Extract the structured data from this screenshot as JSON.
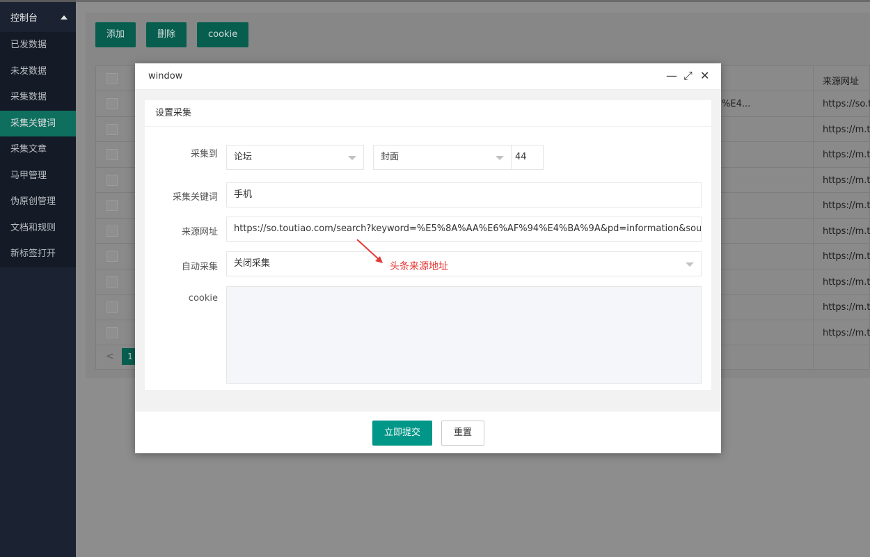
{
  "sidebar": {
    "header": "控制台",
    "items": [
      {
        "label": "已发数据"
      },
      {
        "label": "未发数据"
      },
      {
        "label": "采集数据"
      },
      {
        "label": "采集关键词",
        "active": true
      },
      {
        "label": "采集文章"
      },
      {
        "label": "马甲管理"
      },
      {
        "label": "伪原创管理"
      },
      {
        "label": "文档和规则"
      },
      {
        "label": "新标签打开"
      }
    ]
  },
  "toolbar": {
    "add_label": "添加",
    "delete_label": "删除",
    "cookie_label": "cookie"
  },
  "table": {
    "url_header": "来源网址",
    "rows": [
      {
        "mid": "%E4...",
        "url": "https://so.tou"
      },
      {
        "mid": "",
        "url": "https://m.tou"
      },
      {
        "mid": "",
        "url": "https://m.tou"
      },
      {
        "mid": "",
        "url": "https://m.tou"
      },
      {
        "mid": "",
        "url": "https://m.tou"
      },
      {
        "mid": "",
        "url": "https://m.tou"
      },
      {
        "mid": "",
        "url": "https://m.tou"
      },
      {
        "mid": "",
        "url": "https://m.tou"
      },
      {
        "mid": "",
        "url": "https://m.tou"
      },
      {
        "mid": "",
        "url": "https://m.tou"
      }
    ],
    "pager": {
      "prev": "<",
      "page": "1"
    }
  },
  "modal": {
    "title": "window",
    "minimize_glyph": "—",
    "maximize_glyph": "⤢",
    "close_glyph": "✕",
    "card_title": "设置采集",
    "fields": {
      "collect_to_label": "采集到",
      "collect_to_value": "论坛",
      "cover_value": "封面",
      "count_value": "44",
      "keyword_label": "采集关键词",
      "keyword_value": "手机",
      "source_url_label": "来源网址",
      "source_url_value": "https://so.toutiao.com/search?keyword=%E5%8A%AA%E6%AF%94%E4%BA%9A&pd=information&source=input&",
      "auto_collect_label": "自动采集",
      "auto_collect_value": "关闭采集",
      "cookie_label": "cookie",
      "cookie_value": ""
    },
    "annotation": "头条来源地址",
    "submit_label": "立即提交",
    "reset_label": "重置"
  },
  "colors": {
    "accent": "#009688",
    "sidebar_bg": "#1b2332",
    "annotation": "#e53935"
  }
}
